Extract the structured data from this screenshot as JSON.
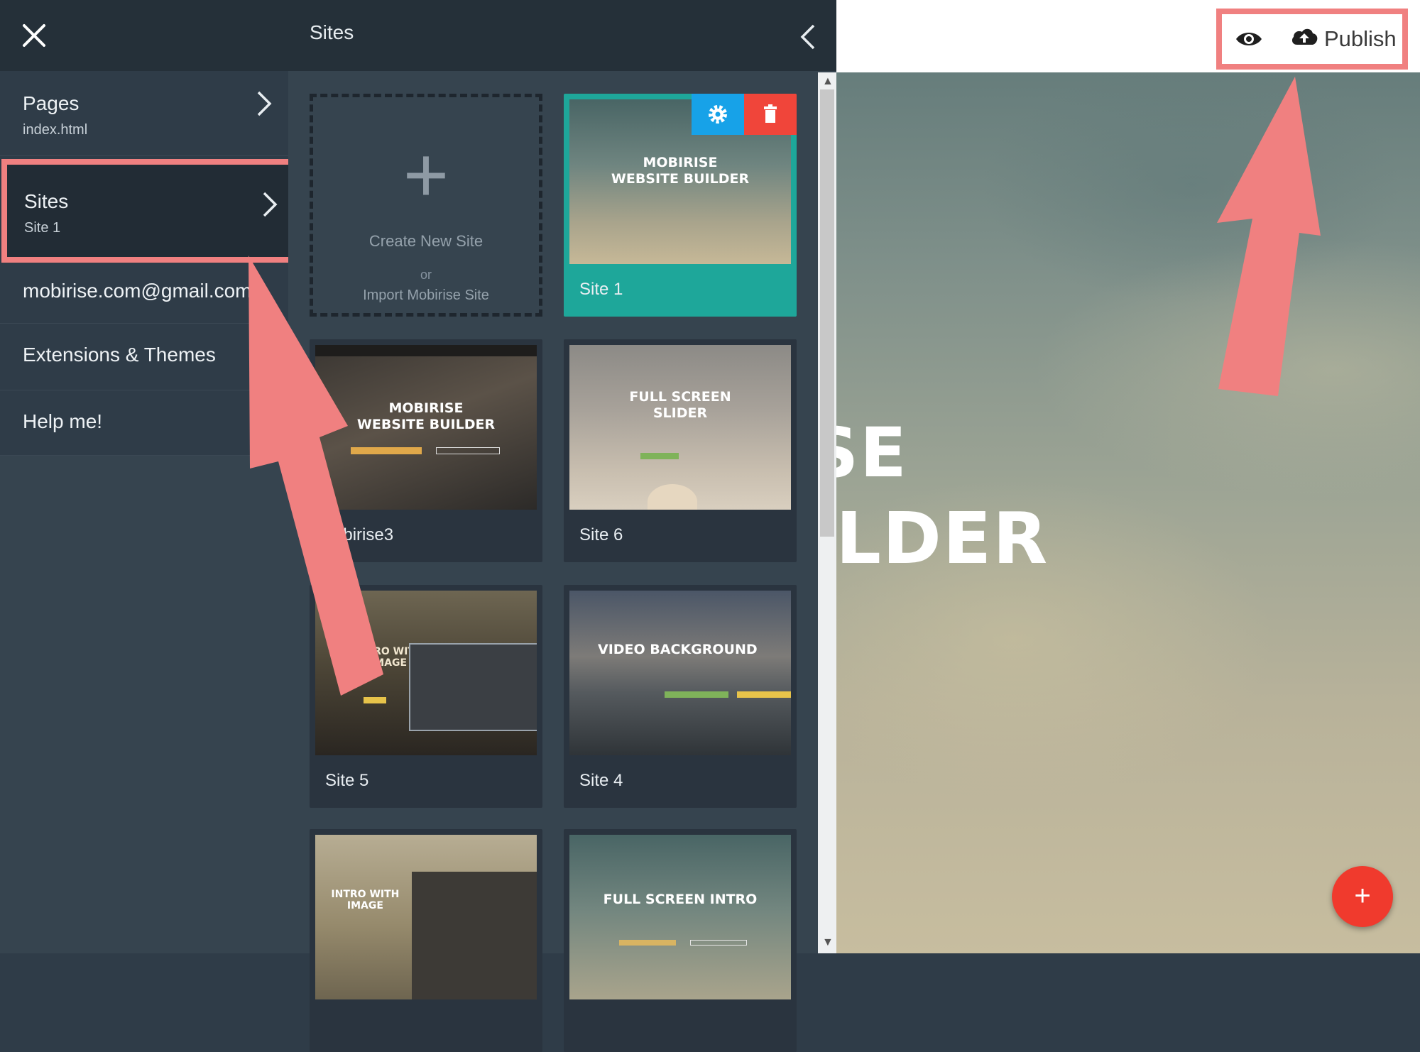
{
  "menu": {
    "close_icon": "close-icon",
    "items": [
      {
        "label": "Pages",
        "sub": "index.html"
      },
      {
        "label": "Sites",
        "sub": "Site 1"
      },
      {
        "label": "mobirise.com@gmail.com"
      },
      {
        "label": "Extensions & Themes"
      },
      {
        "label": "Help me!"
      }
    ]
  },
  "panel": {
    "title": "Sites",
    "new_site": {
      "label": "Create New Site",
      "or": "or",
      "import": "Import Mobirise Site"
    },
    "sites": [
      {
        "label": "Site 1",
        "thumb_text": [
          "MOBIRISE",
          "WEBSITE BUILDER"
        ],
        "active": true
      },
      {
        "label": "obirise3",
        "thumb_text": [
          "MOBIRISE",
          "WEBSITE BUILDER"
        ]
      },
      {
        "label": "Site 6",
        "thumb_text": [
          "FULL SCREEN",
          "SLIDER"
        ]
      },
      {
        "label": "Site 5",
        "thumb_text": [
          "INTRO WITH",
          "IMAGE"
        ]
      },
      {
        "label": "Site 4",
        "thumb_text": [
          "VIDEO BACKGROUND"
        ]
      },
      {
        "label": "",
        "thumb_text": [
          "INTRO WITH",
          "IMAGE"
        ]
      },
      {
        "label": "",
        "thumb_text": [
          "FULL SCREEN INTRO"
        ]
      }
    ]
  },
  "preview": {
    "hero_line1": "SE",
    "hero_line2": "ILDER",
    "publish_label": "Publish",
    "fab_label": "+"
  },
  "colors": {
    "annotation": "#f08080",
    "active_site": "#1ea79a",
    "settings": "#17a2e8",
    "delete": "#f0453a",
    "fab": "#f03a2d"
  }
}
